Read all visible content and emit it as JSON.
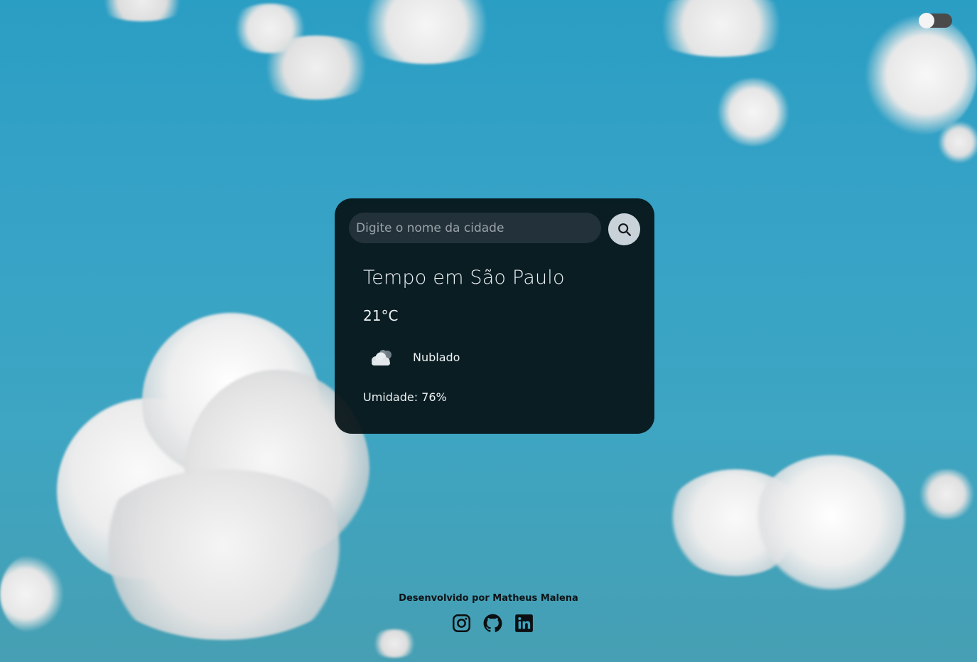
{
  "theme_toggle": {
    "state": "off",
    "knob_color": "#f4f4f4",
    "track_color": "#4a4a4a"
  },
  "search": {
    "placeholder": "Digite o nome da cidade",
    "value": "",
    "button_icon": "search-icon"
  },
  "weather": {
    "title": "Tempo em São Paulo",
    "temperature": "21°C",
    "condition": "Nublado",
    "condition_icon": "cloudy-icon",
    "humidity": "Umidade: 76%"
  },
  "footer": {
    "credit": "Desenvolvido por Matheus Malena",
    "links": [
      {
        "name": "Instagram",
        "icon": "instagram-icon"
      },
      {
        "name": "GitHub",
        "icon": "github-icon"
      },
      {
        "name": "LinkedIn",
        "icon": "linkedin-icon"
      }
    ]
  },
  "colors": {
    "sky": "#37a3c6",
    "card_background": "#061418",
    "search_field": "#23323a",
    "search_button": "#c8d2d8",
    "text": "#eef2f4"
  }
}
